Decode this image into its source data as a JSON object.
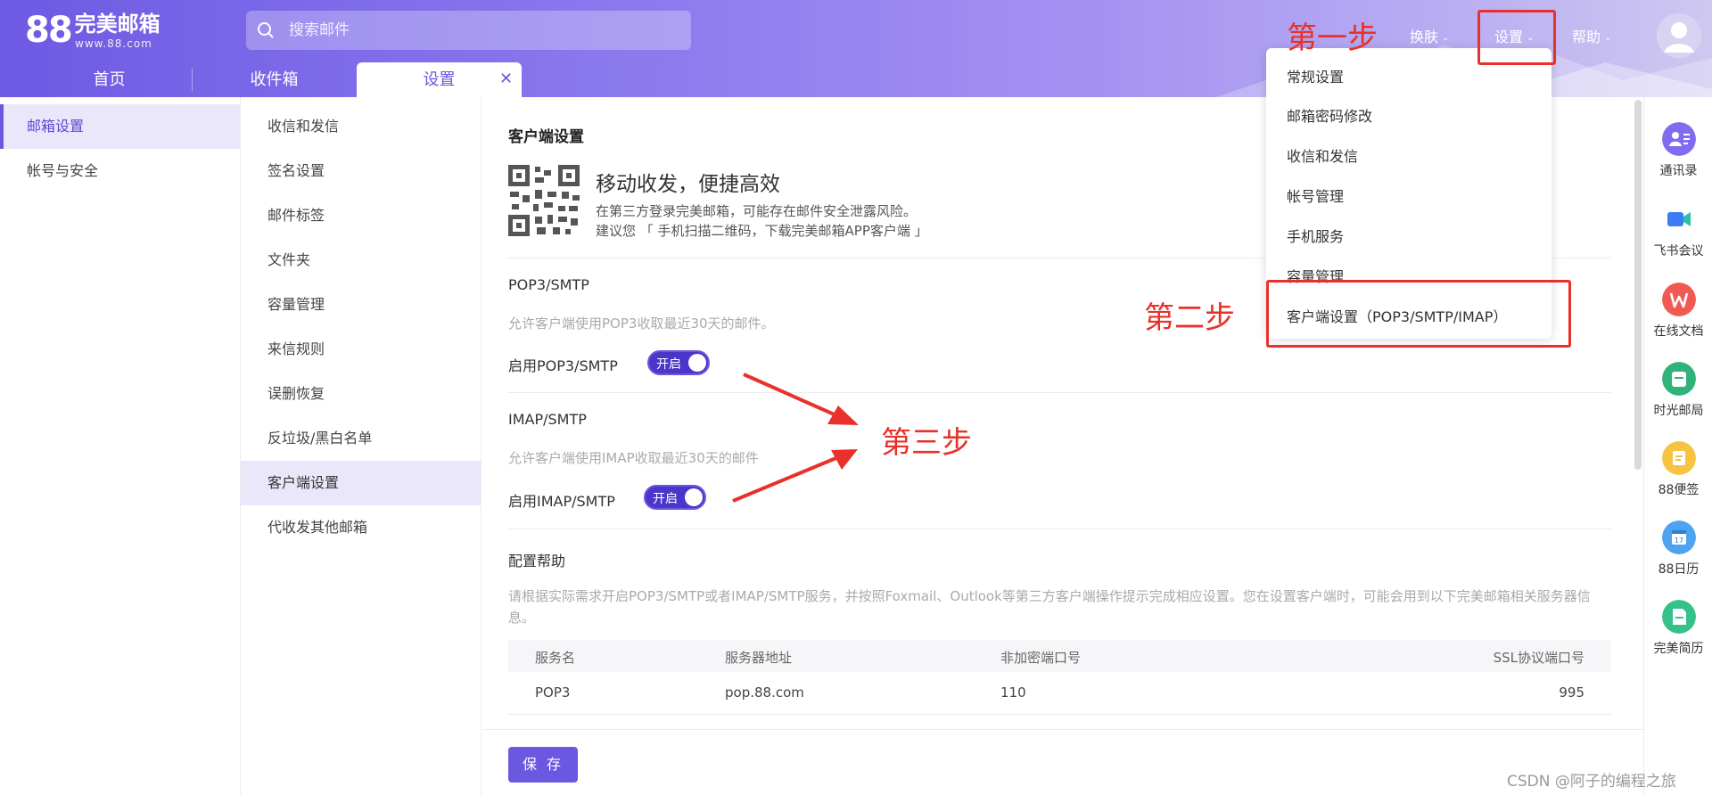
{
  "header": {
    "logo_big": "88",
    "logo_cn": "完美邮箱",
    "logo_url": "www.88.com",
    "search_placeholder": "搜索邮件",
    "nav": {
      "skin": "换肤",
      "settings": "设置",
      "help": "帮助"
    }
  },
  "tabs": [
    {
      "label": "首页"
    },
    {
      "label": "收件箱"
    },
    {
      "label": "设置"
    }
  ],
  "sidebar_main": [
    {
      "label": "邮箱设置"
    },
    {
      "label": "帐号与安全"
    }
  ],
  "sidebar_sub": [
    {
      "label": "收信和发信"
    },
    {
      "label": "签名设置"
    },
    {
      "label": "邮件标签"
    },
    {
      "label": "文件夹"
    },
    {
      "label": "容量管理"
    },
    {
      "label": "来信规则"
    },
    {
      "label": "误删恢复"
    },
    {
      "label": "反垃圾/黑白名单"
    },
    {
      "label": "客户端设置"
    },
    {
      "label": "代收发其他邮箱"
    }
  ],
  "main": {
    "title": "客户端设置",
    "promo_title": "移动收发，便捷高效",
    "promo_line1": "在第三方登录完美邮箱，可能存在邮件安全泄露风险。",
    "promo_line2": "建议您 「 手机扫描二维码，下载完美邮箱APP客户端 」",
    "pop": {
      "title": "POP3/SMTP",
      "desc": "允许客户端使用POP3收取最近30天的邮件。",
      "label": "启用POP3/SMTP",
      "toggle": "开启"
    },
    "imap": {
      "title": "IMAP/SMTP",
      "desc": "允许客户端使用IMAP收取最近30天的邮件",
      "label": "启用IMAP/SMTP",
      "toggle": "开启"
    },
    "help_title": "配置帮助",
    "help_text": "请根据实际需求开启POP3/SMTP或者IMAP/SMTP服务，并按照Foxmail、Outlook等第三方客户端操作提示完成相应设置。您在设置客户端时，可能会用到以下完美邮箱相关服务器信息。",
    "table": {
      "headers": [
        "服务名",
        "服务器地址",
        "非加密端口号",
        "SSL协议端口号"
      ],
      "rows": [
        {
          "name": "POP3",
          "server": "pop.88.com",
          "port": "110",
          "ssl": "995"
        }
      ]
    },
    "save": "保 存"
  },
  "rail": [
    {
      "label": "通讯录",
      "icon": "contacts-icon",
      "color": "#7f6cf0"
    },
    {
      "label": "飞书会议",
      "icon": "video-meeting-icon",
      "color": "#ffffff"
    },
    {
      "label": "在线文档",
      "icon": "wps-icon",
      "color": "#f05a52"
    },
    {
      "label": "时光邮局",
      "icon": "mailbox-icon",
      "color": "#2fb37a"
    },
    {
      "label": "88便签",
      "icon": "note-icon",
      "color": "#f6c343"
    },
    {
      "label": "88日历",
      "icon": "calendar-icon",
      "color": "#4da3ef"
    },
    {
      "label": "完美简历",
      "icon": "resume-icon",
      "color": "#36c08a"
    }
  ],
  "dropdown": [
    {
      "label": "常规设置"
    },
    {
      "label": "邮箱密码修改"
    },
    {
      "label": "收信和发信"
    },
    {
      "label": "帐号管理"
    },
    {
      "label": "手机服务"
    },
    {
      "label": "容量管理"
    },
    {
      "label": "客户端设置（POP3/SMTP/IMAP）"
    }
  ],
  "annotations": {
    "step1": "第一步",
    "step2": "第二步",
    "step3": "第三步"
  },
  "watermark": "CSDN @阿子的编程之旅",
  "colors": {
    "accent": "#6b57e0",
    "annotation": "#e8312a"
  }
}
